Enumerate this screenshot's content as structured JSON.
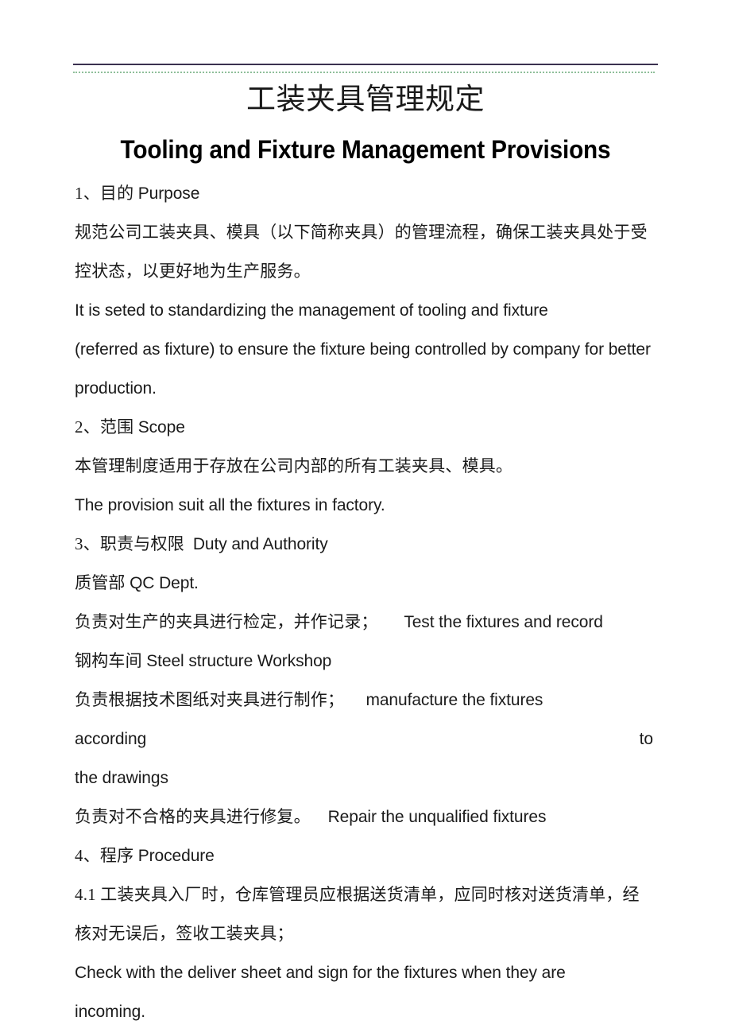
{
  "document": {
    "title_cn": "工装夹具管理规定",
    "title_en": "Tooling and Fixture Management Provisions",
    "header_rule_color": "#3b3050",
    "header_dotted_color": "#8fbf9a",
    "page_background": "#ffffff",
    "text_color": "#1b1b1b"
  },
  "sections": [
    {
      "id": "purpose",
      "heading_cn": "1、目的 ",
      "heading_en": "Purpose",
      "lines": [
        "规范公司工装夹具、模具（以下简称夹具）的管理流程，确保工装夹具处于受",
        "控状态，以更好地为生产服务。",
        "It is seted to standardizing the management of tooling and fixture",
        "(referred as fixture) to ensure the fixture being controlled by company for better",
        "production."
      ]
    },
    {
      "id": "scope",
      "heading_cn": "2、范围 ",
      "heading_en": "Scope",
      "lines": [
        "本管理制度适用于存放在公司内部的所有工装夹具、模具。",
        "The provision suit all the fixtures in factory."
      ]
    },
    {
      "id": "duty-and-authority",
      "heading_cn": "3、职责与权限  ",
      "heading_en": "Duty and Authority",
      "lines": [
        "质管部 QC Dept.",
        "负责对生产的夹具进行检定，并作记录；      Test the fixtures and record",
        "钢构车间 Steel structure Workshop",
        "负责根据技术图纸对夹具进行制作；     manufacture the fixtures",
        "according   to",
        "the drawings",
        "负责对不合格的夹具进行修复。    Repair the unqualified fixtures"
      ]
    },
    {
      "id": "procedure",
      "heading_cn": "4、程序 ",
      "heading_en": "Procedure",
      "lines": [
        "4.1 工装夹具入厂时，仓库管理员应根据送货清单，应同时核对送货清单，经",
        "核对无误后，签收工装夹具；",
        "Check with the deliver sheet and sign for the fixtures when they are",
        "incoming."
      ]
    }
  ],
  "body_lines": [
    {
      "kind": "heading",
      "cn": "1、目的 ",
      "en": "Purpose"
    },
    {
      "kind": "cn",
      "text": "规范公司工装夹具、模具（以下简称夹具）的管理流程，确保工装夹具处于受"
    },
    {
      "kind": "cn",
      "text": "控状态，以更好地为生产服务。"
    },
    {
      "kind": "en",
      "text": "It is seted to standardizing the management of tooling and fixture"
    },
    {
      "kind": "en",
      "text": "(referred as fixture) to ensure the fixture being controlled by company for better"
    },
    {
      "kind": "en",
      "text": "production."
    },
    {
      "kind": "heading",
      "cn": "2、范围 ",
      "en": "Scope"
    },
    {
      "kind": "cn",
      "text": "本管理制度适用于存放在公司内部的所有工装夹具、模具。"
    },
    {
      "kind": "en",
      "text": "The provision suit all the fixtures in factory."
    },
    {
      "kind": "heading",
      "cn": "3、职责与权限  ",
      "en": "Duty and Authority"
    },
    {
      "kind": "heading",
      "cn": "质管部 ",
      "en": "QC Dept."
    },
    {
      "kind": "mixed",
      "cn": "负责对生产的夹具进行检定，并作记录；      ",
      "en": "Test the fixtures and record"
    },
    {
      "kind": "heading",
      "cn": "钢构车间 ",
      "en": "Steel structure Workshop"
    },
    {
      "kind": "mixed",
      "cn": "负责根据技术图纸对夹具进行制作；     ",
      "en": "manufacture the fixtures"
    },
    {
      "kind": "justify",
      "left": "according",
      "right": "to"
    },
    {
      "kind": "en",
      "text": "the drawings"
    },
    {
      "kind": "mixed",
      "cn": "负责对不合格的夹具进行修复。    ",
      "en": "Repair the unqualified fixtures"
    },
    {
      "kind": "heading",
      "cn": "4、程序 ",
      "en": "Procedure"
    },
    {
      "kind": "cn",
      "text": "4.1 工装夹具入厂时，仓库管理员应根据送货清单，应同时核对送货清单，经"
    },
    {
      "kind": "cn",
      "text": "核对无误后，签收工装夹具；"
    },
    {
      "kind": "en",
      "text": "Check with the deliver sheet and sign for the fixtures when they are"
    },
    {
      "kind": "en",
      "text": "incoming."
    }
  ]
}
